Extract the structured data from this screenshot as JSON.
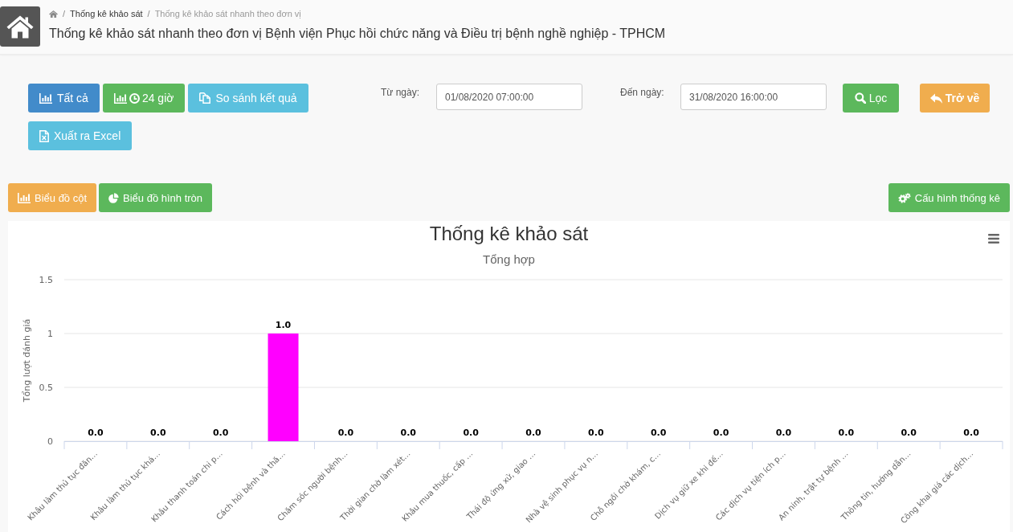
{
  "header": {
    "breadcrumb": {
      "separator": "/",
      "items": [
        {
          "label": "Thống kê khảo sát",
          "selected": false
        },
        {
          "label": "Thống kê khảo sát nhanh theo đơn vị",
          "selected": true
        }
      ]
    },
    "title": "Thống kê khảo sát nhanh theo đơn vị Bệnh viện Phục hồi chức năng và Điều trị bệnh nghề nghiệp - TPHCM"
  },
  "filters": {
    "buttons": [
      {
        "label": "Tất cả",
        "kind": "primary"
      },
      {
        "label": "24 giờ",
        "kind": "success"
      },
      {
        "label": "So sánh kết quả",
        "kind": "info"
      },
      {
        "label": "Xuất ra Excel",
        "kind": "info"
      }
    ],
    "from_date": {
      "label": "Từ ngày:",
      "value": "01/08/2020 07:00:00"
    },
    "to_date": {
      "label": "Đến ngày:",
      "value": "31/08/2020 16:00:00"
    },
    "actions": [
      {
        "label": "Lọc",
        "kind": "success"
      },
      {
        "label": "Trở về",
        "kind": "warning"
      }
    ]
  },
  "chart_buttons": [
    {
      "label": "Biểu đồ cột",
      "selected": true
    },
    {
      "label": "Biểu đồ hình tròn",
      "selected": false
    }
  ],
  "config_button": {
    "label": "Cấu hình thống kê",
    "kind": "success"
  },
  "chart": {
    "subtitle": "Tổng hợp",
    "chart_data": {
      "type": "bar",
      "title": "Thống kê khảo sát",
      "ylabel": "Tổng lượt đánh giá",
      "categories": [
        "Khâu làm thủ tục đăn…",
        "Khâu làm thủ tục khá…",
        "Khâu thanh toán chi p…",
        "Cách hỏi bệnh và thă…",
        "Chăm sóc người bệnh…",
        "Thời gian chờ làm xét…",
        "Khâu mua thuốc, cấp …",
        "Thái độ ứng xử, giao …",
        "Nhà vệ sinh phục vụ n…",
        "Chỗ ngồi chờ khám, c…",
        "Dịch vụ giữ xe khi đế…",
        "Các dịch vụ tiện ích p…",
        "An ninh, trật tự bệnh …",
        "Thông tin, hướng dẫn…",
        "Công khai giá các dịch…"
      ],
      "series": [
        {
          "color": "#ff00ff",
          "values": [
            0,
            0,
            0,
            1,
            0,
            0,
            0,
            0,
            0,
            0,
            0,
            0,
            0,
            0,
            0
          ]
        }
      ],
      "ylim": [
        0,
        1.5
      ],
      "yticks": [
        0,
        0.5,
        1,
        1.5
      ],
      "value_labels": [
        "0.0",
        "0.0",
        "0.0",
        "1.0",
        "0.0",
        "0.0",
        "0.0",
        "0.0",
        "0.0",
        "0.0",
        "0.0",
        "0.0",
        "0.0",
        "0.0",
        "0.0"
      ]
    }
  }
}
